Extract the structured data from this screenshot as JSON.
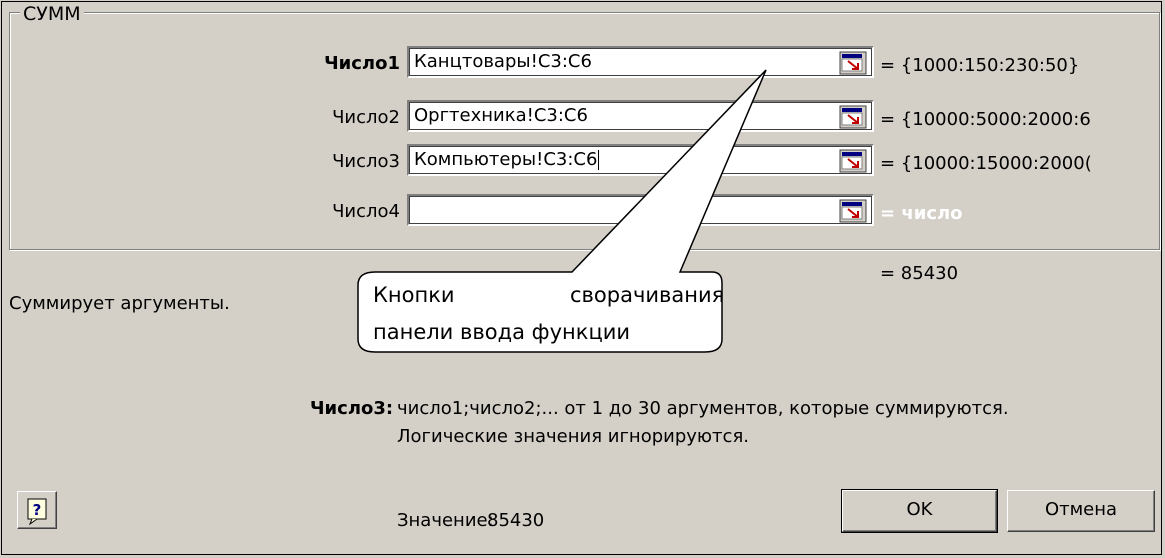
{
  "dialog": {
    "function_name": "СУММ",
    "args": [
      {
        "label": "Число1",
        "value": "Канцтовары!C3:C6",
        "result": "= {1000:150:230:50}"
      },
      {
        "label": "Число2",
        "value": "Оргтехника!C3:C6",
        "result": "= {10000:5000:2000:6"
      },
      {
        "label": "Число3",
        "value": "Компьютеры!C3:C6",
        "result": "= {10000:15000:2000("
      },
      {
        "label": "Число4",
        "value": "",
        "result": "= число"
      }
    ],
    "total_result": "= 85430",
    "description": "Суммирует аргументы.",
    "arg_help_label": "Число3:",
    "arg_help_line1": "число1;число2;... от 1 до 30 аргументов, которые суммируются.",
    "arg_help_line2": "Логические значения игнорируются.",
    "value_label": "Значение:",
    "value": "85430",
    "ok_label": "OK",
    "cancel_label": "Отмена",
    "help_icon": "help-question-icon",
    "collapse_icon": "collapse-dialog-icon"
  },
  "callout": {
    "line1_left": "Кнопки",
    "line1_right": "сворачивания",
    "line2": "панели ввода функции"
  }
}
